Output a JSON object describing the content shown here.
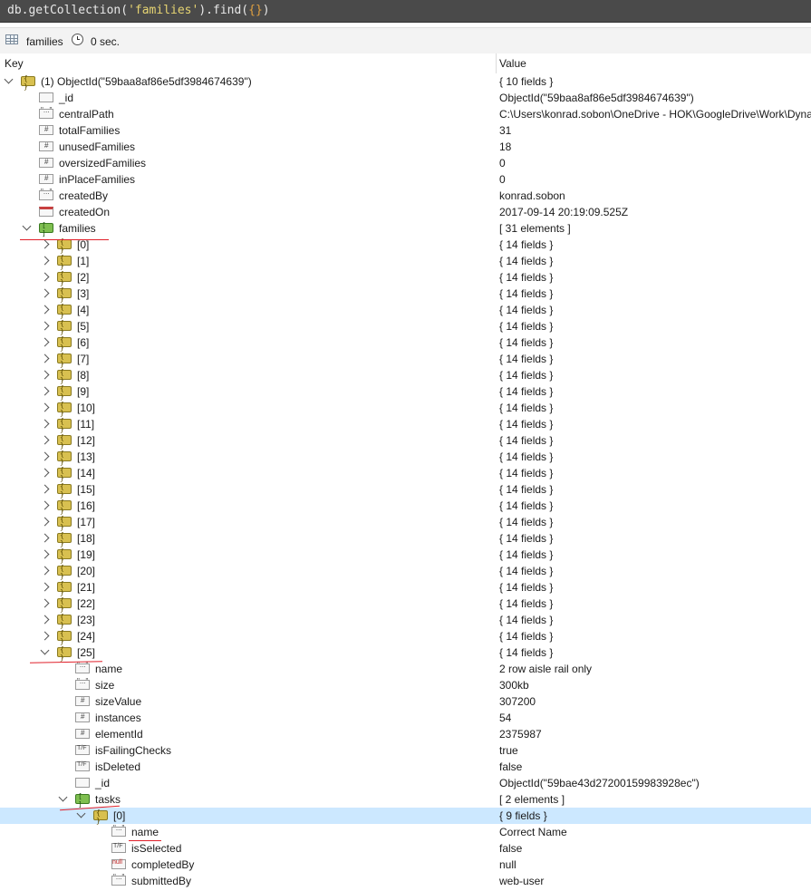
{
  "query_bar": {
    "prefix": "db.getCollection(",
    "collection_arg": "'families'",
    "mid": ").find(",
    "filter_arg": "{}",
    "suffix": ")"
  },
  "status_bar": {
    "collection": "families",
    "time": "0 sec."
  },
  "columns": {
    "key": "Key",
    "value": "Value"
  },
  "colors": {
    "selected_row": "#cce8ff",
    "annotation": "#e0202a"
  },
  "rows": [
    {
      "key": "(1) ObjectId(\"59baa8af86e5df3984674639\")",
      "value": "{ 10 fields }",
      "icon": "obj",
      "arrow": "open",
      "depth": 0
    },
    {
      "key": "_id",
      "value": "ObjectId(\"59baa8af86e5df3984674639\")",
      "icon": "oid",
      "depth": 1
    },
    {
      "key": "centralPath",
      "value": "C:\\Users\\konrad.sobon\\OneDrive - HOK\\GoogleDrive\\Work\\Dyna",
      "icon": "str",
      "depth": 1
    },
    {
      "key": "totalFamilies",
      "value": "31",
      "icon": "num",
      "depth": 1
    },
    {
      "key": "unusedFamilies",
      "value": "18",
      "icon": "num",
      "depth": 1
    },
    {
      "key": "oversizedFamilies",
      "value": "0",
      "icon": "num",
      "depth": 1
    },
    {
      "key": "inPlaceFamilies",
      "value": "0",
      "icon": "num",
      "depth": 1
    },
    {
      "key": "createdBy",
      "value": "konrad.sobon",
      "icon": "str",
      "depth": 1
    },
    {
      "key": "createdOn",
      "value": "2017-09-14 20:19:09.525Z",
      "icon": "date",
      "depth": 1
    },
    {
      "key": "families",
      "value": "[ 31 elements ]",
      "icon": "arr",
      "arrow": "open",
      "depth": 1
    },
    {
      "key": "[0]",
      "value": "{ 14 fields }",
      "icon": "obj",
      "arrow": "closed",
      "depth": 2
    },
    {
      "key": "[1]",
      "value": "{ 14 fields }",
      "icon": "obj",
      "arrow": "closed",
      "depth": 2
    },
    {
      "key": "[2]",
      "value": "{ 14 fields }",
      "icon": "obj",
      "arrow": "closed",
      "depth": 2
    },
    {
      "key": "[3]",
      "value": "{ 14 fields }",
      "icon": "obj",
      "arrow": "closed",
      "depth": 2
    },
    {
      "key": "[4]",
      "value": "{ 14 fields }",
      "icon": "obj",
      "arrow": "closed",
      "depth": 2
    },
    {
      "key": "[5]",
      "value": "{ 14 fields }",
      "icon": "obj",
      "arrow": "closed",
      "depth": 2
    },
    {
      "key": "[6]",
      "value": "{ 14 fields }",
      "icon": "obj",
      "arrow": "closed",
      "depth": 2
    },
    {
      "key": "[7]",
      "value": "{ 14 fields }",
      "icon": "obj",
      "arrow": "closed",
      "depth": 2
    },
    {
      "key": "[8]",
      "value": "{ 14 fields }",
      "icon": "obj",
      "arrow": "closed",
      "depth": 2
    },
    {
      "key": "[9]",
      "value": "{ 14 fields }",
      "icon": "obj",
      "arrow": "closed",
      "depth": 2
    },
    {
      "key": "[10]",
      "value": "{ 14 fields }",
      "icon": "obj",
      "arrow": "closed",
      "depth": 2
    },
    {
      "key": "[11]",
      "value": "{ 14 fields }",
      "icon": "obj",
      "arrow": "closed",
      "depth": 2
    },
    {
      "key": "[12]",
      "value": "{ 14 fields }",
      "icon": "obj",
      "arrow": "closed",
      "depth": 2
    },
    {
      "key": "[13]",
      "value": "{ 14 fields }",
      "icon": "obj",
      "arrow": "closed",
      "depth": 2
    },
    {
      "key": "[14]",
      "value": "{ 14 fields }",
      "icon": "obj",
      "arrow": "closed",
      "depth": 2
    },
    {
      "key": "[15]",
      "value": "{ 14 fields }",
      "icon": "obj",
      "arrow": "closed",
      "depth": 2
    },
    {
      "key": "[16]",
      "value": "{ 14 fields }",
      "icon": "obj",
      "arrow": "closed",
      "depth": 2
    },
    {
      "key": "[17]",
      "value": "{ 14 fields }",
      "icon": "obj",
      "arrow": "closed",
      "depth": 2
    },
    {
      "key": "[18]",
      "value": "{ 14 fields }",
      "icon": "obj",
      "arrow": "closed",
      "depth": 2
    },
    {
      "key": "[19]",
      "value": "{ 14 fields }",
      "icon": "obj",
      "arrow": "closed",
      "depth": 2
    },
    {
      "key": "[20]",
      "value": "{ 14 fields }",
      "icon": "obj",
      "arrow": "closed",
      "depth": 2
    },
    {
      "key": "[21]",
      "value": "{ 14 fields }",
      "icon": "obj",
      "arrow": "closed",
      "depth": 2
    },
    {
      "key": "[22]",
      "value": "{ 14 fields }",
      "icon": "obj",
      "arrow": "closed",
      "depth": 2
    },
    {
      "key": "[23]",
      "value": "{ 14 fields }",
      "icon": "obj",
      "arrow": "closed",
      "depth": 2
    },
    {
      "key": "[24]",
      "value": "{ 14 fields }",
      "icon": "obj",
      "arrow": "closed",
      "depth": 2
    },
    {
      "key": "[25]",
      "value": "{ 14 fields }",
      "icon": "obj",
      "arrow": "open",
      "depth": 2
    },
    {
      "key": "name",
      "value": "2 row aisle rail only",
      "icon": "str",
      "depth": 3
    },
    {
      "key": "size",
      "value": "300kb",
      "icon": "str",
      "depth": 3
    },
    {
      "key": "sizeValue",
      "value": "307200",
      "icon": "num",
      "depth": 3
    },
    {
      "key": "instances",
      "value": "54",
      "icon": "num",
      "depth": 3
    },
    {
      "key": "elementId",
      "value": "2375987",
      "icon": "num",
      "depth": 3
    },
    {
      "key": "isFailingChecks",
      "value": "true",
      "icon": "bool",
      "depth": 3
    },
    {
      "key": "isDeleted",
      "value": "false",
      "icon": "bool",
      "depth": 3
    },
    {
      "key": "_id",
      "value": "ObjectId(\"59bae43d27200159983928ec\")",
      "icon": "oid",
      "depth": 3
    },
    {
      "key": "tasks",
      "value": "[ 2 elements ]",
      "icon": "arr",
      "arrow": "open",
      "depth": 3
    },
    {
      "key": "[0]",
      "value": "{ 9 fields }",
      "icon": "obj",
      "arrow": "open",
      "depth": 4,
      "selected": true
    },
    {
      "key": "name",
      "value": "Correct Name",
      "icon": "str",
      "depth": 5
    },
    {
      "key": "isSelected",
      "value": "false",
      "icon": "bool",
      "depth": 5
    },
    {
      "key": "completedBy",
      "value": "null",
      "icon": "nul",
      "depth": 5
    },
    {
      "key": "submittedBy",
      "value": "web-user",
      "icon": "str",
      "depth": 5
    }
  ]
}
